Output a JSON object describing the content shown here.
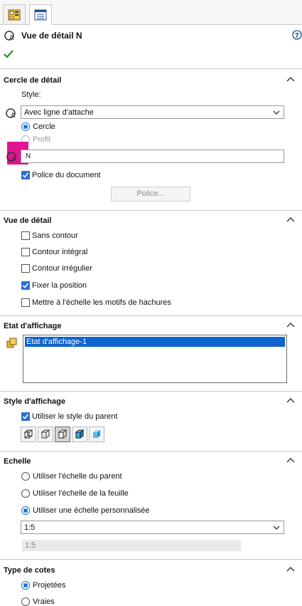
{
  "header": {
    "title": "Vue de détail N",
    "icons": [
      "feature-manager-icon",
      "property-manager-icon",
      "detail-view-icon",
      "help-icon",
      "ok-check-icon"
    ],
    "ok_color": "#2e8b2e"
  },
  "detail_circle": {
    "title": "Cercle de détail",
    "style_label": "Style:",
    "style_value": "Avec ligne d'attache",
    "radio_circle": "Cercle",
    "radio_profile": "Profil",
    "label_field_value": "N",
    "doc_font_label": "Police du document",
    "font_button": "Police...",
    "highlight_color": "#e0158f"
  },
  "detail_view": {
    "title": "Vue de détail",
    "options": [
      "Sans contour",
      "Contour intégral",
      "Contour irrégulier",
      "Fixer la position",
      "Mettre à l'échelle les motifs de hachures"
    ],
    "checked": [
      false,
      false,
      false,
      true,
      false
    ]
  },
  "display_state": {
    "title": "Etat d'affichage",
    "items": [
      "Etat d'affichage-1"
    ]
  },
  "display_style": {
    "title": "Style d'affichage",
    "use_parent_label": "Utiliser le style du parent",
    "buttons": [
      "wireframe-icon",
      "hidden-lines-visible-icon",
      "hidden-lines-removed-icon",
      "shaded-with-edges-icon",
      "shaded-icon"
    ],
    "active_index": 2
  },
  "scale": {
    "title": "Echelle",
    "options": [
      "Utiliser l'échelle du parent",
      "Utiliser l'échelle de la feuille",
      "Utiliser une échelle personnalisée"
    ],
    "selected_index": 2,
    "combo_value": "1:5",
    "field_value": "1:5"
  },
  "dim_type": {
    "title": "Type de cotes",
    "options": [
      "Projetées",
      "Vraies"
    ],
    "selected_index": 0
  }
}
